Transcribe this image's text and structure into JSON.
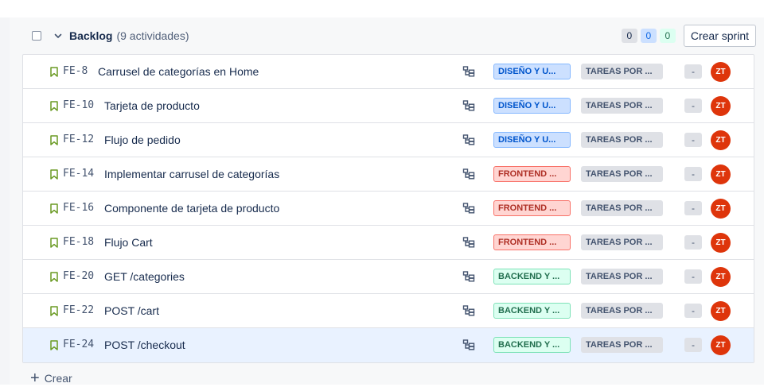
{
  "header": {
    "title": "Backlog",
    "count": "(9 actividades)",
    "pills": [
      {
        "value": "0",
        "color": "gray"
      },
      {
        "value": "0",
        "color": "blue"
      },
      {
        "value": "0",
        "color": "green"
      }
    ],
    "create_sprint_label": "Crear sprint"
  },
  "rows": [
    {
      "key": "FE-8",
      "title": "Carrusel de categorías en Home",
      "epic": "DISEÑO Y U...",
      "epic_color": "blue",
      "status": "TAREAS POR ...",
      "estimate": "-",
      "assignee": "ZT",
      "selected": false
    },
    {
      "key": "FE-10",
      "title": "Tarjeta de producto",
      "epic": "DISEÑO Y U...",
      "epic_color": "blue",
      "status": "TAREAS POR ...",
      "estimate": "-",
      "assignee": "ZT",
      "selected": false
    },
    {
      "key": "FE-12",
      "title": "Flujo de pedido",
      "epic": "DISEÑO Y U...",
      "epic_color": "blue",
      "status": "TAREAS POR ...",
      "estimate": "-",
      "assignee": "ZT",
      "selected": false
    },
    {
      "key": "FE-14",
      "title": "Implementar carrusel de categorías",
      "epic": "FRONTEND ...",
      "epic_color": "red",
      "status": "TAREAS POR ...",
      "estimate": "-",
      "assignee": "ZT",
      "selected": false
    },
    {
      "key": "FE-16",
      "title": "Componente de tarjeta de producto",
      "epic": "FRONTEND ...",
      "epic_color": "red",
      "status": "TAREAS POR ...",
      "estimate": "-",
      "assignee": "ZT",
      "selected": false
    },
    {
      "key": "FE-18",
      "title": "Flujo Cart",
      "epic": "FRONTEND ...",
      "epic_color": "red",
      "status": "TAREAS POR ...",
      "estimate": "-",
      "assignee": "ZT",
      "selected": false
    },
    {
      "key": "FE-20",
      "title": "GET /categories",
      "epic": "BACKEND Y ...",
      "epic_color": "green",
      "status": "TAREAS POR ...",
      "estimate": "-",
      "assignee": "ZT",
      "selected": false
    },
    {
      "key": "FE-22",
      "title": "POST /cart",
      "epic": "BACKEND Y ...",
      "epic_color": "green",
      "status": "TAREAS POR ...",
      "estimate": "-",
      "assignee": "ZT",
      "selected": false
    },
    {
      "key": "FE-24",
      "title": "POST /checkout",
      "epic": "BACKEND Y ...",
      "epic_color": "green",
      "status": "TAREAS POR ...",
      "estimate": "-",
      "assignee": "ZT",
      "selected": true
    }
  ],
  "footer": {
    "create_label": "Crear"
  },
  "colors": {
    "story_icon": "#6a9a23",
    "avatar": "#de350b",
    "selected_row": "#e9f2ff"
  },
  "icons": {
    "row_type": "bookmark-icon",
    "child_issues": "subtask-tree-icon",
    "expand": "chevron-down-icon",
    "create": "plus-icon"
  }
}
